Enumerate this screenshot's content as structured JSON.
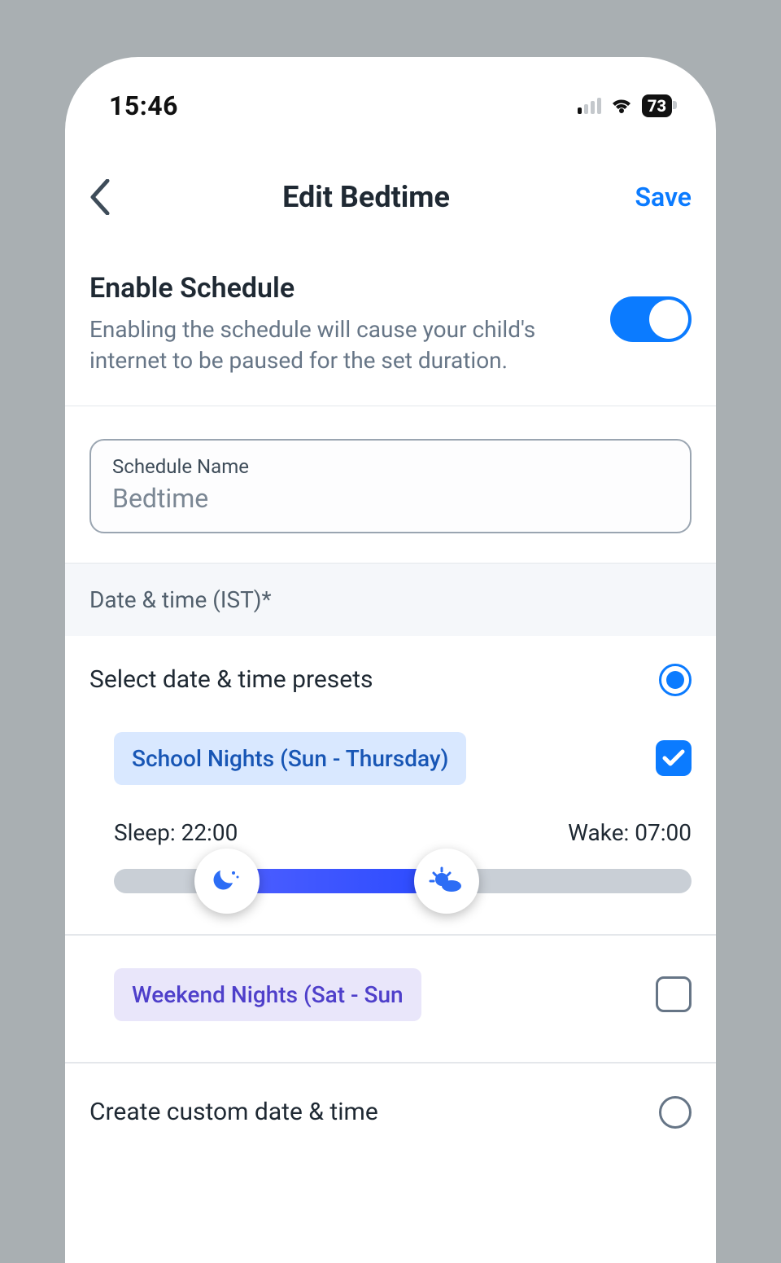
{
  "status": {
    "time": "15:46",
    "battery": "73"
  },
  "nav": {
    "title": "Edit Bedtime",
    "save": "Save"
  },
  "enable": {
    "title": "Enable Schedule",
    "desc": "Enabling the schedule will cause your child's internet to be paused for the set duration."
  },
  "schedule_name": {
    "label": "Schedule Name",
    "value": "Bedtime"
  },
  "datetime_header": "Date & time (IST)*",
  "presets": {
    "select_label": "Select date & time presets",
    "school": {
      "chip": "School Nights (Sun - Thursday)",
      "sleep_label": "Sleep: 22:00",
      "wake_label": "Wake: 07:00"
    },
    "weekend": {
      "chip": "Weekend Nights (Sat - Sun"
    }
  },
  "custom": {
    "label": "Create custom date & time"
  }
}
